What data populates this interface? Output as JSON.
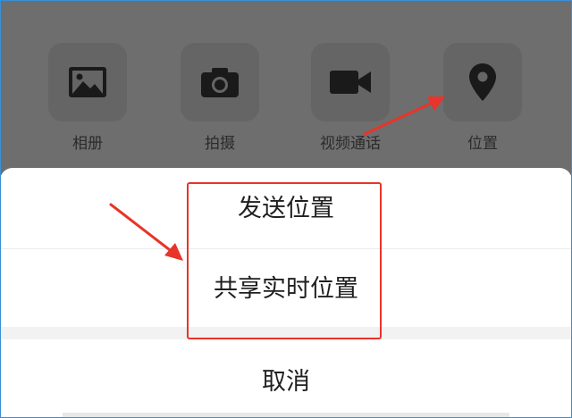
{
  "toolbar": {
    "items": [
      {
        "label": "相册",
        "icon": "image-icon"
      },
      {
        "label": "拍摄",
        "icon": "camera-icon"
      },
      {
        "label": "视频通话",
        "icon": "video-camera-icon"
      },
      {
        "label": "位置",
        "icon": "location-pin-icon"
      }
    ]
  },
  "sheet": {
    "options": [
      "发送位置",
      "共享实时位置"
    ],
    "cancel_label": "取消"
  },
  "colors": {
    "overlay": "#6f6f6f",
    "icon": "#1a1a1a",
    "annotation": "#e8342a"
  }
}
